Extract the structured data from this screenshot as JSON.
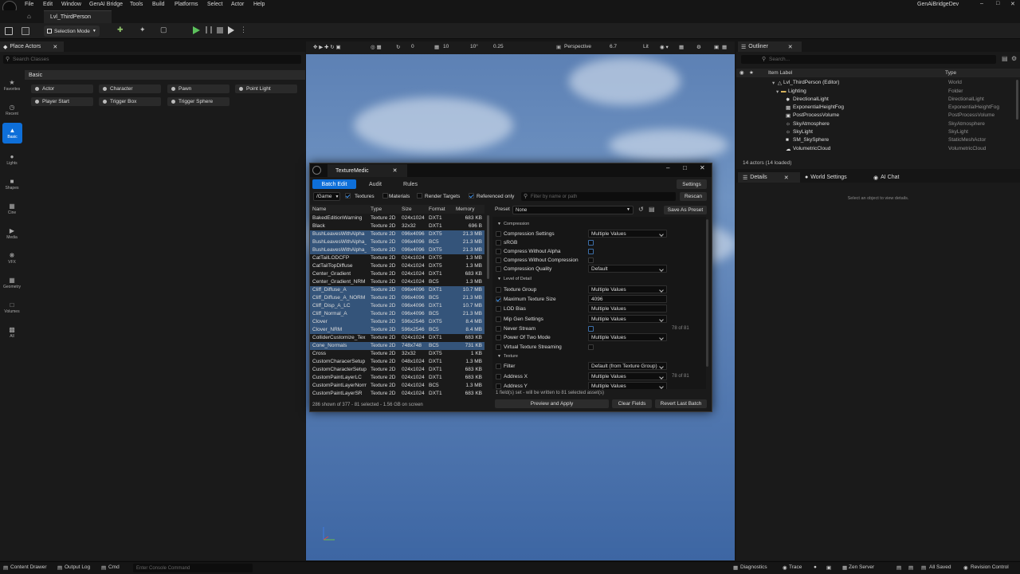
{
  "menubar": {
    "items": [
      "File",
      "Edit",
      "Window",
      "GenAI Bridge",
      "Tools",
      "Build",
      "Platforms",
      "Select",
      "Actor",
      "Help"
    ],
    "project_name": "GenAiBridgeDev"
  },
  "level_tab": {
    "label": "Lvl_ThirdPerson"
  },
  "toolbar": {
    "selection_mode": "Selection Mode"
  },
  "place_actors": {
    "tab_label": "Place Actors",
    "search_placeholder": "Search Classes",
    "section": "Basic",
    "categories": [
      "Favorites",
      "Recent",
      "Basic",
      "Lights",
      "Shapes",
      "Cine",
      "Media",
      "VFX",
      "Geometry",
      "Volumes",
      "All"
    ],
    "actors": [
      "Actor",
      "Character",
      "Pawn",
      "Point Light",
      "Player Start",
      "Trigger Box",
      "Trigger Sphere"
    ]
  },
  "viewport": {
    "grid_snap": "10",
    "rot_snap": "10°",
    "scale_snap": "0.25",
    "angle": "0",
    "view_mode": "Perspective",
    "camera_speed": "6.7",
    "lit": "Lit"
  },
  "outliner": {
    "tab_label": "Outliner",
    "search_placeholder": "Search...",
    "col_label": "Item Label",
    "col_type": "Type",
    "rows": [
      {
        "name": "Lvl_ThirdPerson (Editor)",
        "type": "World"
      },
      {
        "name": "Lighting",
        "type": "Folder"
      },
      {
        "name": "DirectionalLight",
        "type": "DirectionalLight"
      },
      {
        "name": "ExponentialHeightFog",
        "type": "ExponentialHeightFog"
      },
      {
        "name": "PostProcessVolume",
        "type": "PostProcessVolume"
      },
      {
        "name": "SkyAtmosphere",
        "type": "SkyAtmosphere"
      },
      {
        "name": "SkyLight",
        "type": "SkyLight"
      },
      {
        "name": "SM_SkySphere",
        "type": "StaticMeshActor"
      },
      {
        "name": "VolumetricCloud",
        "type": "VolumetricCloud"
      }
    ],
    "count": "14 actors (14 loaded)"
  },
  "details": {
    "tabs": [
      "Details",
      "World Settings",
      "AI Chat"
    ],
    "hint": "Select an object to view details."
  },
  "texturemedic": {
    "title": "TextureMedic",
    "tabs": [
      "Batch Edit",
      "Audit",
      "Rules"
    ],
    "settings_label": "Settings",
    "path": "/Game",
    "filters": [
      "Textures",
      "Materials",
      "Render Targets",
      "Referenced only"
    ],
    "search_placeholder": "Filter by name or path",
    "rescan_label": "Rescan",
    "columns": [
      "Name",
      "Type",
      "Size",
      "Format",
      "Memory"
    ],
    "rows": [
      {
        "name": "BakedEditionWarning",
        "type": "Texture 2D",
        "size": "024x1024",
        "format": "DXT1",
        "mem": "683 KB",
        "sel": false
      },
      {
        "name": "Black",
        "type": "Texture 2D",
        "size": "32x32",
        "format": "DXT1",
        "mem": "696 B",
        "sel": false
      },
      {
        "name": "BushLeavesWithAlpha",
        "type": "Texture 2D",
        "size": "096x4096",
        "format": "DXT5",
        "mem": "21.3 MB",
        "sel": true
      },
      {
        "name": "BushLeavesWithAlpha_",
        "type": "Texture 2D",
        "size": "096x4096",
        "format": "BC5",
        "mem": "21.3 MB",
        "sel": true
      },
      {
        "name": "BushLeavesWithAlpha_",
        "type": "Texture 2D",
        "size": "096x4096",
        "format": "DXT5",
        "mem": "21.3 MB",
        "sel": true
      },
      {
        "name": "CatTailLODCFP",
        "type": "Texture 2D",
        "size": "024x1024",
        "format": "DXT5",
        "mem": "1.3 MB",
        "sel": false
      },
      {
        "name": "CatTailTopDiffuse",
        "type": "Texture 2D",
        "size": "024x1024",
        "format": "DXT5",
        "mem": "1.3 MB",
        "sel": false
      },
      {
        "name": "Center_Gradient",
        "type": "Texture 2D",
        "size": "024x1024",
        "format": "DXT1",
        "mem": "683 KB",
        "sel": false
      },
      {
        "name": "Center_Gradient_NRM",
        "type": "Texture 2D",
        "size": "024x1024",
        "format": "BC5",
        "mem": "1.3 MB",
        "sel": false
      },
      {
        "name": "Cliff_Diffuse_A",
        "type": "Texture 2D",
        "size": "096x4096",
        "format": "DXT1",
        "mem": "10.7 MB",
        "sel": true
      },
      {
        "name": "Cliff_Diffuse_A_NORM",
        "type": "Texture 2D",
        "size": "096x4096",
        "format": "BC5",
        "mem": "21.3 MB",
        "sel": true
      },
      {
        "name": "Cliff_Disp_A_LC",
        "type": "Texture 2D",
        "size": "096x4096",
        "format": "DXT1",
        "mem": "10.7 MB",
        "sel": true
      },
      {
        "name": "Cliff_Normal_A",
        "type": "Texture 2D",
        "size": "096x4096",
        "format": "BC5",
        "mem": "21.3 MB",
        "sel": true
      },
      {
        "name": "Clover",
        "type": "Texture 2D",
        "size": "596x2546",
        "format": "DXT5",
        "mem": "8.4 MB",
        "sel": true
      },
      {
        "name": "Clover_NRM",
        "type": "Texture 2D",
        "size": "596x2546",
        "format": "BC5",
        "mem": "8.4 MB",
        "sel": true
      },
      {
        "name": "ColliderCustomize_Tex",
        "type": "Texture 2D",
        "size": "024x1024",
        "format": "DXT1",
        "mem": "683 KB",
        "sel": false
      },
      {
        "name": "Cone_Normals",
        "type": "Texture 2D",
        "size": "748x748",
        "format": "BC5",
        "mem": "731 KB",
        "sel": true
      },
      {
        "name": "Cross",
        "type": "Texture 2D",
        "size": "32x32",
        "format": "DXT5",
        "mem": "1 KB",
        "sel": false
      },
      {
        "name": "CustomCharacerSetup",
        "type": "Texture 2D",
        "size": "048x1024",
        "format": "DXT1",
        "mem": "1.3 MB",
        "sel": false
      },
      {
        "name": "CustomCharacterSetup",
        "type": "Texture 2D",
        "size": "024x1024",
        "format": "DXT1",
        "mem": "683 KB",
        "sel": false
      },
      {
        "name": "CustomPaintLayerLC",
        "type": "Texture 2D",
        "size": "024x1024",
        "format": "DXT1",
        "mem": "683 KB",
        "sel": false
      },
      {
        "name": "CustomPaintLayerNorm",
        "type": "Texture 2D",
        "size": "024x1024",
        "format": "BC5",
        "mem": "1.3 MB",
        "sel": false
      },
      {
        "name": "CustomPaintLayerSR",
        "type": "Texture 2D",
        "size": "024x1024",
        "format": "DXT1",
        "mem": "683 KB",
        "sel": false
      }
    ],
    "footer": "286 shown of 377 - 81 selected - 1.56 GB on screen",
    "preset_label": "Preset",
    "preset_value": "None",
    "save_preset_label": "Save As Preset",
    "sections": {
      "compression": "Compression",
      "lod": "Level of Detail",
      "texture": "Texture"
    },
    "props": {
      "compression_settings": {
        "label": "Compression Settings",
        "value": "Multiple Values"
      },
      "srgb": {
        "label": "sRGB"
      },
      "compress_no_alpha": {
        "label": "Compress Without Alpha"
      },
      "compress_no_compression": {
        "label": "Compress Without Compression"
      },
      "compression_quality": {
        "label": "Compression Quality",
        "value": "Default"
      },
      "texture_group": {
        "label": "Texture Group",
        "value": "Multiple Values"
      },
      "max_texture_size": {
        "label": "Maximum Texture Size",
        "value": "4096"
      },
      "lod_bias": {
        "label": "LOD Bias",
        "value": "Multiple Values"
      },
      "mip_gen": {
        "label": "Mip Gen Settings",
        "value": "Multiple Values"
      },
      "never_stream": {
        "label": "Never Stream",
        "of": "78 of 81"
      },
      "power_of_two": {
        "label": "Power Of Two Mode",
        "value": "Multiple Values"
      },
      "vts": {
        "label": "Virtual Texture Streaming"
      },
      "filter": {
        "label": "Filter",
        "value": "Default (from Texture Group)"
      },
      "address_x": {
        "label": "Address X",
        "value": "Multiple Values",
        "of": "78 of 81"
      },
      "address_y": {
        "label": "Address Y",
        "value": "Multiple Values"
      }
    },
    "note": "1 field(s) set - will be written to 81 selected asset(s)",
    "buttons": {
      "preview": "Preview and Apply",
      "clear": "Clear Fields",
      "revert": "Revert Last Batch"
    }
  },
  "statusbar": {
    "content_drawer": "Content Drawer",
    "output_log": "Output Log",
    "cmd": "Cmd",
    "console_placeholder": "Enter Console Command",
    "diagnostics": "Diagnostics",
    "trace": "Trace",
    "zen": "Zen Server",
    "saved": "All Saved",
    "revision": "Revision Control"
  },
  "colors": {
    "accent": "#0e6fd9",
    "selected_row": "#34547a"
  }
}
